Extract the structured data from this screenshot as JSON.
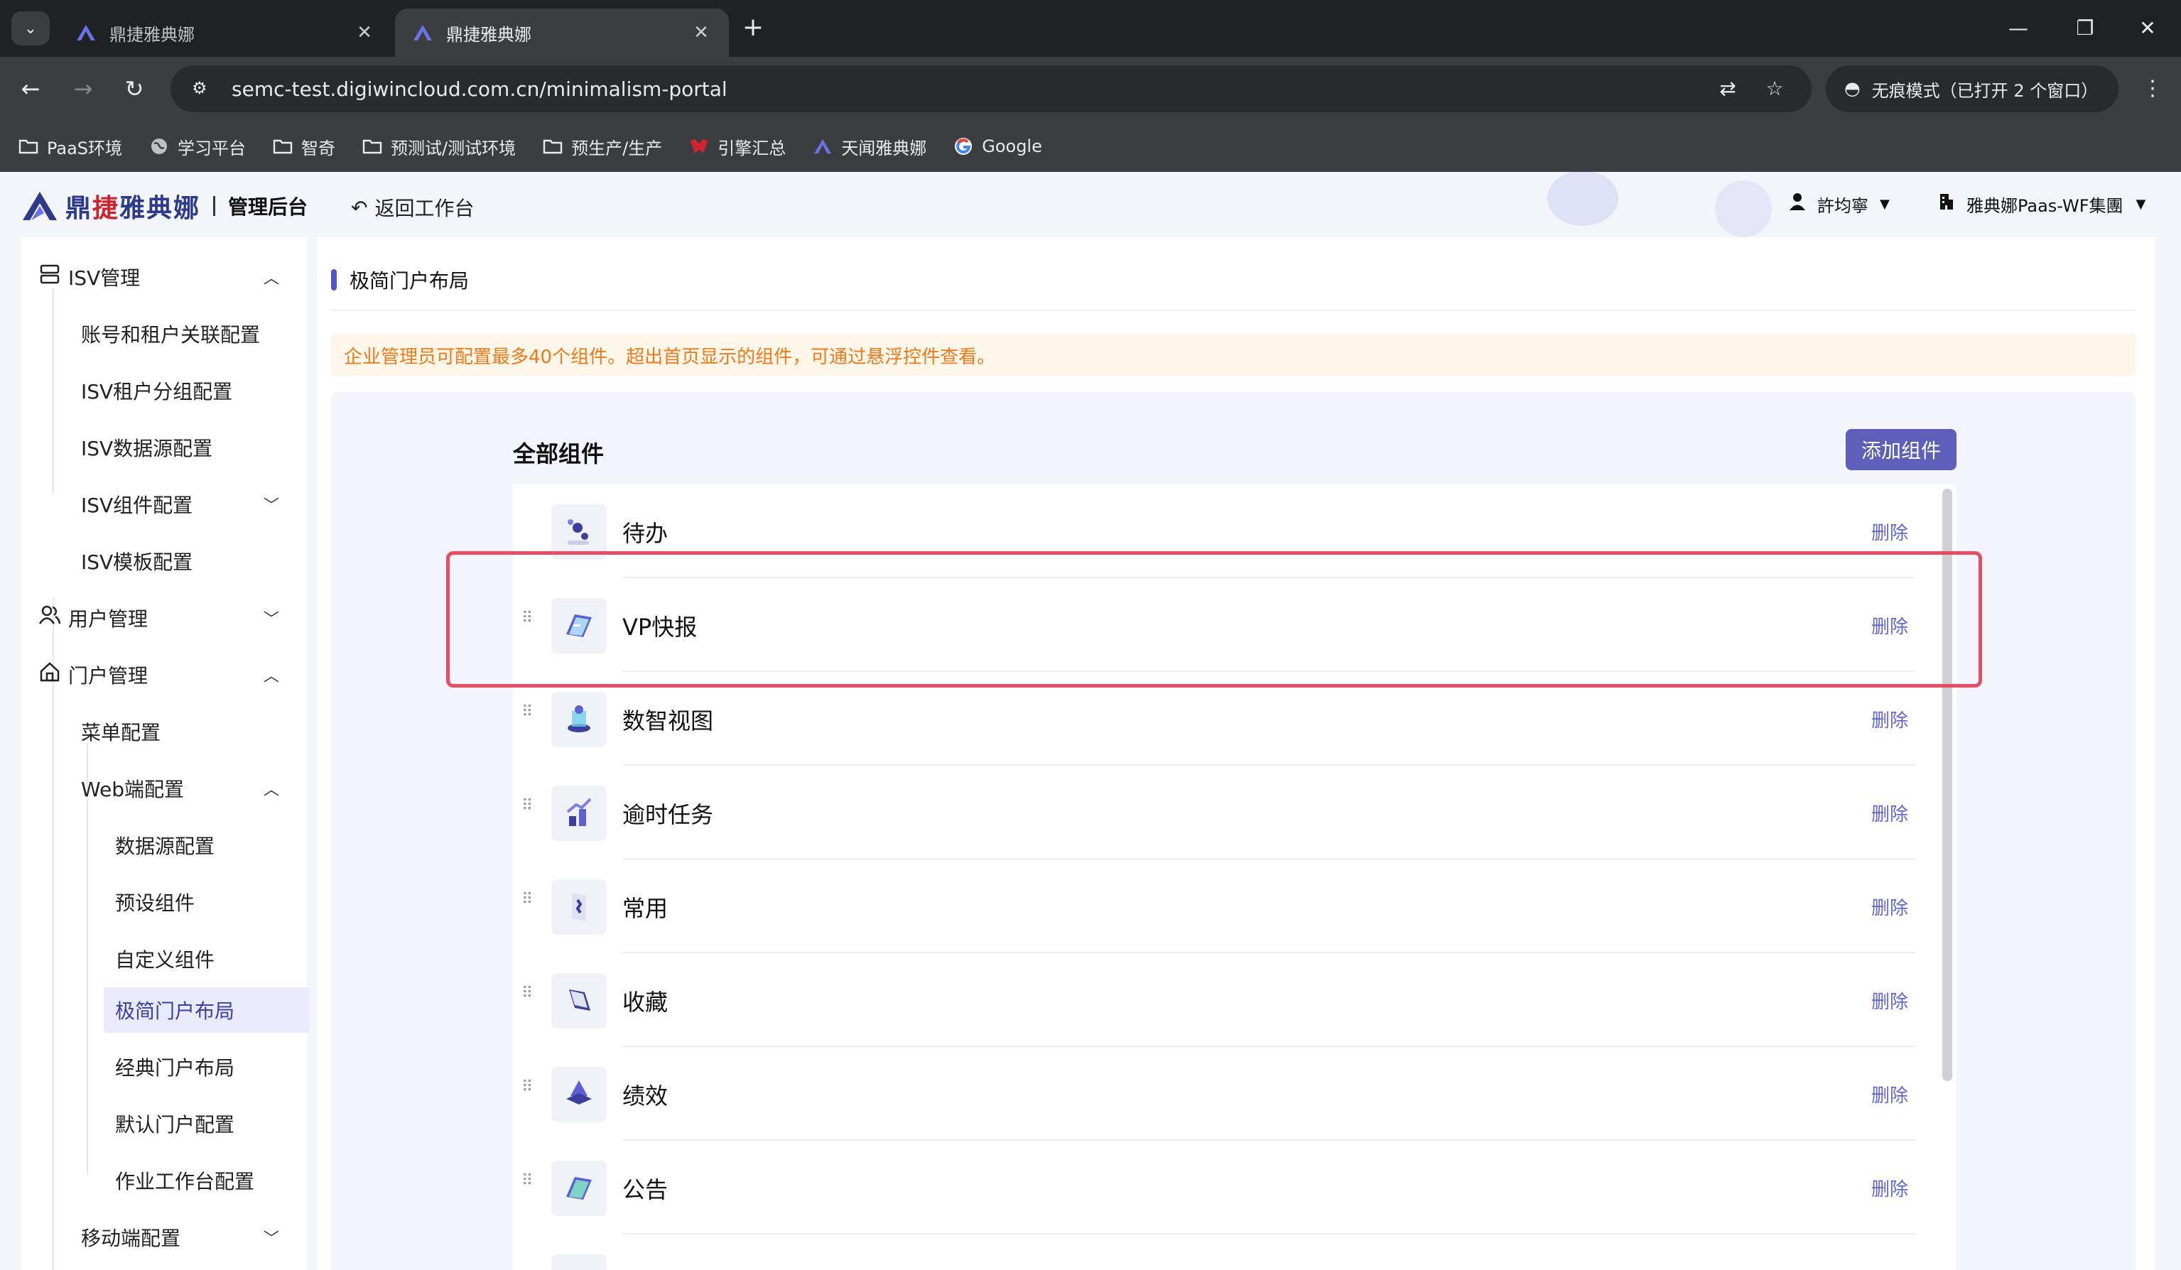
{
  "browser": {
    "tabs": [
      {
        "title": "鼎捷雅典娜",
        "active": false
      },
      {
        "title": "鼎捷雅典娜",
        "active": true
      }
    ],
    "url": "semc-test.digiwincloud.com.cn/minimalism-portal",
    "incognito_label": "无痕模式（已打开 2 个窗口）",
    "bookmarks": [
      {
        "label": "PaaS环境",
        "icon": "folder-icon"
      },
      {
        "label": "学习平台",
        "icon": "globe-icon"
      },
      {
        "label": "智奇",
        "icon": "folder-icon"
      },
      {
        "label": "预测试/测试环境",
        "icon": "folder-icon"
      },
      {
        "label": "预生产/生产",
        "icon": "folder-icon"
      },
      {
        "label": "引擎汇总",
        "icon": "engine-icon"
      },
      {
        "label": "天闻雅典娜",
        "icon": "athena-icon"
      },
      {
        "label": "Google",
        "icon": "google-icon"
      }
    ]
  },
  "header": {
    "brand_part1": "鼎",
    "brand_red": "捷",
    "brand_part2": "雅典娜",
    "admin_label": "管理后台",
    "back_label": "返回工作台",
    "user_name": "許均寧",
    "tenant_name": "雅典娜Paas-WF集團"
  },
  "sidebar": {
    "items": [
      {
        "label": "ISV管理",
        "level": 1,
        "icon": "server-icon",
        "caret": "up"
      },
      {
        "label": "账号和租户关联配置",
        "level": 2
      },
      {
        "label": "ISV租户分组配置",
        "level": 2
      },
      {
        "label": "ISV数据源配置",
        "level": 2
      },
      {
        "label": "ISV组件配置",
        "level": 2,
        "caret": "down"
      },
      {
        "label": "ISV模板配置",
        "level": 2
      },
      {
        "label": "用户管理",
        "level": 1,
        "icon": "users-icon",
        "caret": "down"
      },
      {
        "label": "门户管理",
        "level": 1,
        "icon": "home-icon",
        "caret": "up"
      },
      {
        "label": "菜单配置",
        "level": 2
      },
      {
        "label": "Web端配置",
        "level": 2,
        "caret": "up"
      },
      {
        "label": "数据源配置",
        "level": 3
      },
      {
        "label": "预设组件",
        "level": 3
      },
      {
        "label": "自定义组件",
        "level": 3
      },
      {
        "label": "极简门户布局",
        "level": 3,
        "active": true
      },
      {
        "label": "经典门户布局",
        "level": 3
      },
      {
        "label": "默认门户配置",
        "level": 3
      },
      {
        "label": "作业工作台配置",
        "level": 3
      },
      {
        "label": "移动端配置",
        "level": 2,
        "caret": "down"
      }
    ]
  },
  "main": {
    "page_title": "极简门户布局",
    "notice": "企业管理员可配置最多40个组件。超出首页显示的组件，可通过悬浮控件查看。",
    "section_title": "全部组件",
    "add_button": "添加组件",
    "delete_label": "删除",
    "components": [
      {
        "name": "待办",
        "icon": "todo-icon"
      },
      {
        "name": "VP快报",
        "icon": "report-icon",
        "highlighted": true
      },
      {
        "name": "数智视图",
        "icon": "dashboard-icon"
      },
      {
        "name": "逾时任务",
        "icon": "overdue-icon"
      },
      {
        "name": "常用",
        "icon": "bookmark-icon"
      },
      {
        "name": "收藏",
        "icon": "favorite-icon"
      },
      {
        "name": "绩效",
        "icon": "performance-icon"
      },
      {
        "name": "公告",
        "icon": "announcement-icon"
      }
    ]
  },
  "colors": {
    "accent": "#5d5fb9",
    "link": "#6165d8",
    "notice_text": "#f07a1a",
    "highlight": "#e84d63",
    "brand_blue": "#2d3a8c",
    "brand_red": "#d0222c"
  }
}
